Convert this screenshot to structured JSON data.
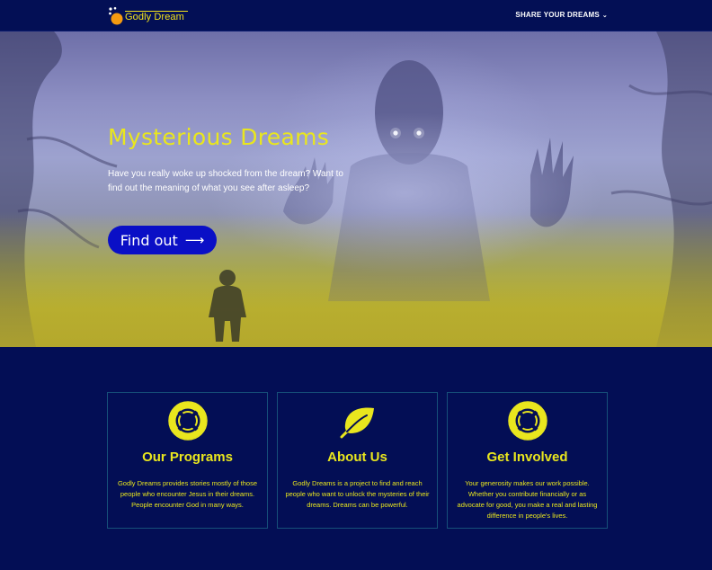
{
  "header": {
    "logo_text": "Godly Dream",
    "nav_label": "SHARE YOUR DREAMS"
  },
  "hero": {
    "title": "Mysterious Dreams",
    "text": "Have you really woke up shocked from the dream? Want to find out the meaning of what you see after asleep?",
    "button_label": "Find out"
  },
  "cards": [
    {
      "title": "Our Programs",
      "icon": "lifebuoy-icon",
      "text": "Godly Dreams provides stories mostly of those people who encounter Jesus in their dreams. People encounter God in many ways."
    },
    {
      "title": "About Us",
      "icon": "leaf-icon",
      "text": "Godly Dreams is a project to find and reach people who want to unlock the mysteries of their dreams. Dreams can be powerful."
    },
    {
      "title": "Get Involved",
      "icon": "lifebuoy-icon",
      "text": "Your generosity makes our work possible. Whether you contribute financially or as advocate for good, you make a real and lasting difference in people's lives."
    }
  ],
  "colors": {
    "background": "#030e55",
    "accent": "#e9e61e",
    "button": "#0a0fc6",
    "card_border": "#16507a"
  }
}
